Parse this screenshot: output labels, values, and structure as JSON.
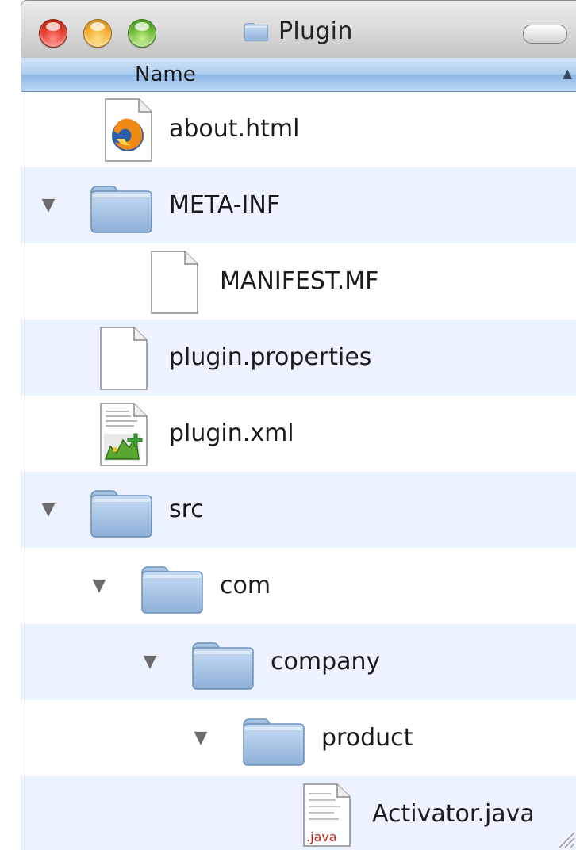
{
  "window": {
    "title": "Plugin"
  },
  "header": {
    "name_column": "Name",
    "sort_indicator": "▲"
  },
  "colors": {
    "header_blue": "#a9cbef",
    "alt_row": "#edf3fe",
    "folder_blue": "#9fbfe2"
  },
  "rows": [
    {
      "label": "about.html",
      "icon": "firefox-html-file-icon",
      "disclosure": ""
    },
    {
      "label": "META-INF",
      "icon": "folder-icon",
      "disclosure": "▼"
    },
    {
      "label": "MANIFEST.MF",
      "icon": "blank-document-icon",
      "disclosure": ""
    },
    {
      "label": "plugin.properties",
      "icon": "blank-document-icon",
      "disclosure": ""
    },
    {
      "label": "plugin.xml",
      "icon": "xml-document-icon",
      "disclosure": ""
    },
    {
      "label": "src",
      "icon": "folder-icon",
      "disclosure": "▼"
    },
    {
      "label": "com",
      "icon": "folder-icon",
      "disclosure": "▼"
    },
    {
      "label": "company",
      "icon": "folder-icon",
      "disclosure": "▼"
    },
    {
      "label": "product",
      "icon": "folder-icon",
      "disclosure": "▼"
    },
    {
      "label": "Activator.java",
      "icon": "java-file-icon",
      "icon_text": ".java",
      "disclosure": ""
    }
  ]
}
